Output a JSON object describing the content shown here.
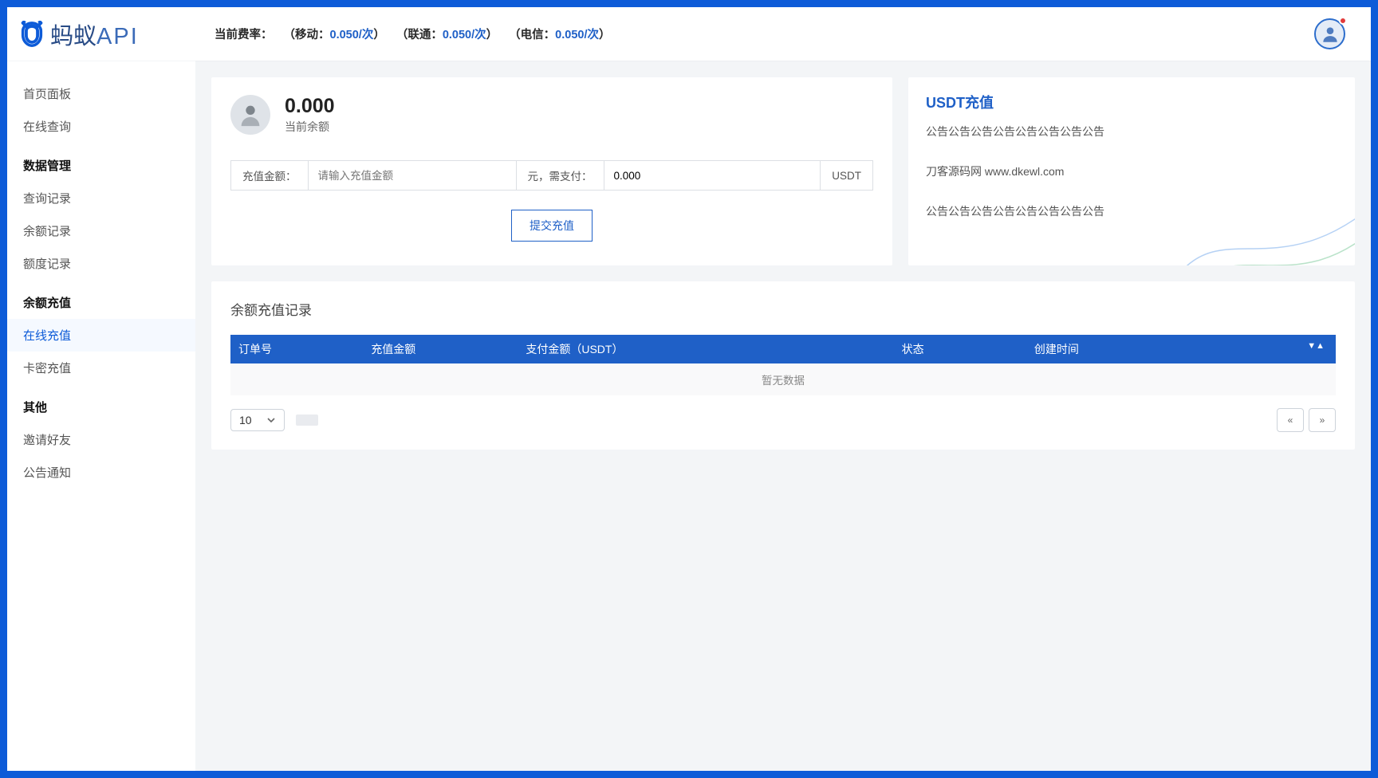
{
  "logo": {
    "text1": "蚂蚁",
    "text2": "API"
  },
  "sidebar": {
    "items": [
      {
        "type": "link",
        "label": "首页面板"
      },
      {
        "type": "link",
        "label": "在线查询"
      },
      {
        "type": "heading",
        "label": "数据管理"
      },
      {
        "type": "link",
        "label": "查询记录"
      },
      {
        "type": "link",
        "label": "余额记录"
      },
      {
        "type": "link",
        "label": "额度记录"
      },
      {
        "type": "heading",
        "label": "余额充值"
      },
      {
        "type": "link",
        "label": "在线充值",
        "active": true
      },
      {
        "type": "link",
        "label": "卡密充值"
      },
      {
        "type": "heading",
        "label": "其他"
      },
      {
        "type": "link",
        "label": "邀请好友"
      },
      {
        "type": "link",
        "label": "公告通知"
      }
    ]
  },
  "topbar": {
    "rate_label": "当前费率：",
    "rates": [
      {
        "prefix": "（移动：",
        "value": "0.050/次",
        "suffix": "）"
      },
      {
        "prefix": "（联通：",
        "value": "0.050/次",
        "suffix": "）"
      },
      {
        "prefix": "（电信：",
        "value": "0.050/次",
        "suffix": "）"
      }
    ]
  },
  "balance": {
    "value": "0.000",
    "label": "当前余额",
    "amount_label": "充值金额：",
    "amount_placeholder": "请输入充值金额",
    "mid_label": "元，需支付：",
    "pay_value": "0.000",
    "unit": "USDT",
    "submit": "提交充值"
  },
  "announcement": {
    "title": "USDT充值",
    "lines": [
      "公告公告公告公告公告公告公告公告",
      "刀客源码网 www.dkewl.com",
      "公告公告公告公告公告公告公告公告"
    ]
  },
  "history": {
    "title": "余额充值记录",
    "columns": [
      "订单号",
      "充值金额",
      "支付金额（USDT）",
      "状态",
      "创建时间"
    ],
    "empty": "暂无数据",
    "page_size": "10"
  }
}
